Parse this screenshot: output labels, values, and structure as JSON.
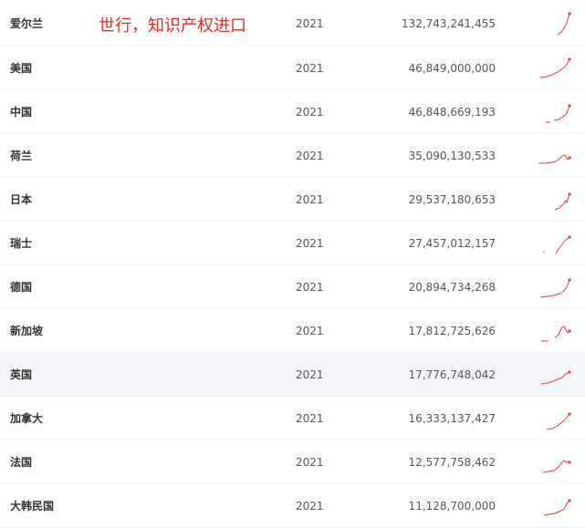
{
  "overlay_title": "世行，知识产权进口",
  "accent_color": "#3fa0f5",
  "sparkline_color": "#e8403a",
  "rows": [
    {
      "country": "爱尔兰",
      "year": "2021",
      "value": "132,743,241,455"
    },
    {
      "country": "美国",
      "year": "2021",
      "value": "46,849,000,000"
    },
    {
      "country": "中国",
      "year": "2021",
      "value": "46,848,669,193"
    },
    {
      "country": "荷兰",
      "year": "2021",
      "value": "35,090,130,533"
    },
    {
      "country": "日本",
      "year": "2021",
      "value": "29,537,180,653"
    },
    {
      "country": "瑞士",
      "year": "2021",
      "value": "27,457,012,157"
    },
    {
      "country": "德国",
      "year": "2021",
      "value": "20,894,734,268"
    },
    {
      "country": "新加坡",
      "year": "2021",
      "value": "17,812,725,626"
    },
    {
      "country": "英国",
      "year": "2021",
      "value": "17,776,748,042"
    },
    {
      "country": "加拿大",
      "year": "2021",
      "value": "16,333,137,427"
    },
    {
      "country": "法国",
      "year": "2021",
      "value": "12,577,758,462"
    },
    {
      "country": "大韩民国",
      "year": "2021",
      "value": "11,128,700,000"
    }
  ]
}
